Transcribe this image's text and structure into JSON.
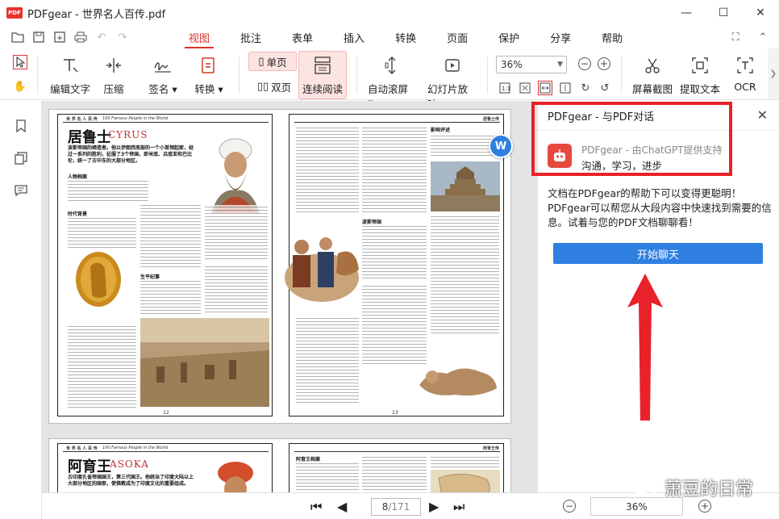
{
  "window": {
    "logo_text": "PDF",
    "title": "PDFgear - 世界名人百传.pdf",
    "minimize": "—",
    "maximize": "☐",
    "close": "✕"
  },
  "menu": {
    "items": [
      "视图",
      "批注",
      "表单",
      "插入",
      "转换",
      "页面",
      "保护",
      "分享",
      "帮助"
    ],
    "active": "视图"
  },
  "toolbar": {
    "edit_text": "编辑文字",
    "compress": "压缩",
    "sign": "签名 ▾",
    "convert": "转换 ▾",
    "single_page": "单页",
    "double_page": "双页",
    "continuous": "连续阅读",
    "auto_scroll": "自动滚屏 ▾",
    "slideshow": "幻灯片放映",
    "zoom": "36%",
    "screenshot": "屏幕截图",
    "extract_text": "提取文本",
    "ocr": "OCR"
  },
  "document": {
    "page12": {
      "header_left": "世 界 名 人 百 传",
      "header_en": "100 Famous People in the World",
      "title_cn": "居鲁士",
      "title_en": "CYRUS",
      "intro_bold": "波斯帝国的缔造者。他以伊朗西南部的一个小首领起家，经过一系列的胜利，征服了3个帝国，即米底、吕底亚和巴比伦，统一了古中东的大部分地区。",
      "sub1": "人物档案",
      "sub2": "时代背景",
      "sub3": "生平纪事",
      "page_number": "12"
    },
    "page13": {
      "header_right": "居鲁士传",
      "sub1": "波斯帝国",
      "sub2": "影响评述",
      "page_number": "13"
    },
    "page_next": {
      "header_left": "世 界 名 人 百 传",
      "header_en": "100 Famous People in the World",
      "title_cn": "阿育王",
      "title_en": "ASOKA",
      "intro_bold": "古印度孔雀帝国国王，第三代国王。他统治了印度大陆以上大部分地区的国家，使佛教成为了印度文化的重要组成。",
      "sub1": "阿育王档案",
      "header_right": "阿育王传"
    }
  },
  "navigation": {
    "current_page": "8",
    "total_pages": "/171",
    "zoom": "36%"
  },
  "chat": {
    "title": "PDFgear - 与PDF对话",
    "bot_name": "PDFgear - 由ChatGPT提供支持",
    "bot_tagline": "沟通，学习，进步",
    "intro": "文档在PDFgear的帮助下可以变得更聪明！PDFgear可以帮您从大段内容中快速找到需要的信息。试着与您的PDF文档聊聊看！",
    "start_button": "开始聊天"
  },
  "watermark": "萧豆的日常",
  "colors": {
    "accent": "#d9352c",
    "button_blue": "#2f7fe0",
    "annotation_red": "#e8212a"
  }
}
